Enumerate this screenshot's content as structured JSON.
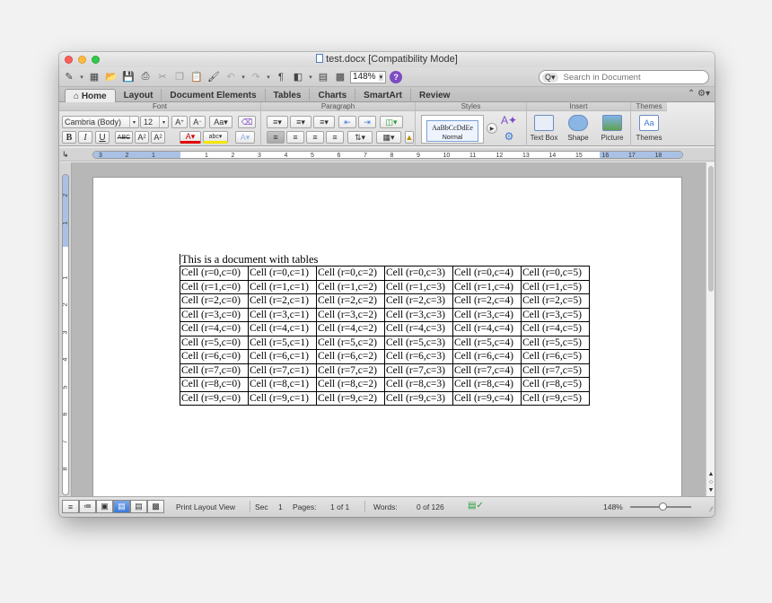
{
  "window": {
    "title": "test.docx [Compatibility Mode]"
  },
  "toolbar": {
    "zoom": "148%",
    "search_placeholder": "Search in Document",
    "search_scope": "Q▾",
    "icons": [
      "new-doc-icon",
      "templates-icon",
      "open-icon",
      "save-icon",
      "print-icon",
      "cut-icon",
      "copy-icon",
      "paste-icon",
      "format-painter-icon",
      "undo-icon",
      "redo-icon",
      "pilcrow-icon",
      "sidebar-icon",
      "gallery-icon",
      "media-icon",
      "help-icon"
    ]
  },
  "tabs": [
    "Home",
    "Layout",
    "Document Elements",
    "Tables",
    "Charts",
    "SmartArt",
    "Review"
  ],
  "tabs_active": "Home",
  "ribbon": {
    "font": {
      "title": "Font",
      "name": "Cambria (Body)",
      "size": "12",
      "row2": [
        "B",
        "I",
        "U"
      ]
    },
    "paragraph": {
      "title": "Paragraph"
    },
    "styles": {
      "title": "Styles",
      "sample": "AaBbCcDdEe",
      "sample_label": "Normal"
    },
    "insert": {
      "title": "Insert",
      "buttons": [
        "Text Box",
        "Shape",
        "Picture"
      ]
    },
    "themes": {
      "title": "Themes",
      "button": "Themes",
      "sample": "Aa"
    }
  },
  "ruler": {
    "labels": [
      "3",
      "2",
      "1",
      "",
      "1",
      "2",
      "3",
      "4",
      "5",
      "6",
      "7",
      "8",
      "9",
      "10",
      "11",
      "12",
      "13",
      "14",
      "15",
      "16",
      "17",
      "18"
    ]
  },
  "vruler": {
    "labels": [
      "2",
      "1",
      "",
      "1",
      "2",
      "3",
      "4",
      "5",
      "6",
      "7",
      "8",
      "9"
    ]
  },
  "document": {
    "heading": "This is a document with tables",
    "table": [
      [
        "Cell (r=0,c=0)",
        "Cell (r=0,c=1)",
        "Cell (r=0,c=2)",
        "Cell (r=0,c=3)",
        "Cell (r=0,c=4)",
        "Cell (r=0,c=5)"
      ],
      [
        "Cell (r=1,c=0)",
        "Cell (r=1,c=1)",
        "Cell (r=1,c=2)",
        "Cell (r=1,c=3)",
        "Cell (r=1,c=4)",
        "Cell (r=1,c=5)"
      ],
      [
        "Cell (r=2,c=0)",
        "Cell (r=2,c=1)",
        "Cell (r=2,c=2)",
        "Cell (r=2,c=3)",
        "Cell (r=2,c=4)",
        "Cell (r=2,c=5)"
      ],
      [
        "Cell (r=3,c=0)",
        "Cell (r=3,c=1)",
        "Cell (r=3,c=2)",
        "Cell (r=3,c=3)",
        "Cell (r=3,c=4)",
        "Cell (r=3,c=5)"
      ],
      [
        "Cell (r=4,c=0)",
        "Cell (r=4,c=1)",
        "Cell (r=4,c=2)",
        "Cell (r=4,c=3)",
        "Cell (r=4,c=4)",
        "Cell (r=4,c=5)"
      ],
      [
        "Cell (r=5,c=0)",
        "Cell (r=5,c=1)",
        "Cell (r=5,c=2)",
        "Cell (r=5,c=3)",
        "Cell (r=5,c=4)",
        "Cell (r=5,c=5)"
      ],
      [
        "Cell (r=6,c=0)",
        "Cell (r=6,c=1)",
        "Cell (r=6,c=2)",
        "Cell (r=6,c=3)",
        "Cell (r=6,c=4)",
        "Cell (r=6,c=5)"
      ],
      [
        "Cell (r=7,c=0)",
        "Cell (r=7,c=1)",
        "Cell (r=7,c=2)",
        "Cell (r=7,c=3)",
        "Cell (r=7,c=4)",
        "Cell (r=7,c=5)"
      ],
      [
        "Cell (r=8,c=0)",
        "Cell (r=8,c=1)",
        "Cell (r=8,c=2)",
        "Cell (r=8,c=3)",
        "Cell (r=8,c=4)",
        "Cell (r=8,c=5)"
      ],
      [
        "Cell (r=9,c=0)",
        "Cell (r=9,c=1)",
        "Cell (r=9,c=2)",
        "Cell (r=9,c=3)",
        "Cell (r=9,c=4)",
        "Cell (r=9,c=5)"
      ]
    ]
  },
  "status": {
    "view": "Print Layout View",
    "sec_label": "Sec",
    "sec_value": "1",
    "pages_label": "Pages:",
    "pages_value": "1 of 1",
    "words_label": "Words:",
    "words_value": "0 of 126",
    "zoom": "148%"
  },
  "colors": {
    "accent": "#3b78d8",
    "ruler_margin": "#a9c1e5"
  }
}
